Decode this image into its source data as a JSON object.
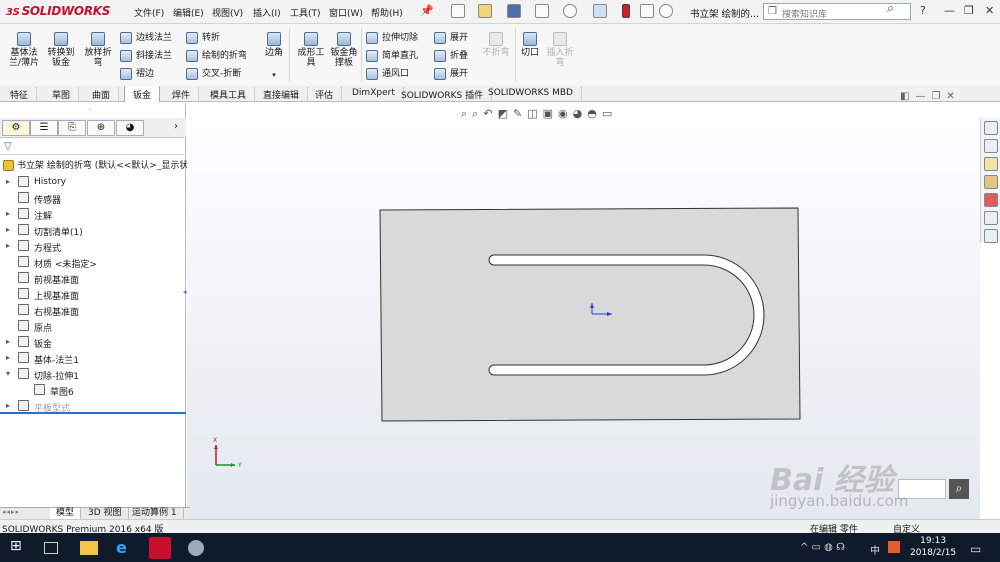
{
  "app": {
    "logo_text": "SOLIDWORKS",
    "logo_prefix": "3S",
    "document_title": "书立架 绘制的..."
  },
  "menu": [
    "文件(F)",
    "编辑(E)",
    "视图(V)",
    "插入(I)",
    "工具(T)",
    "窗口(W)",
    "帮助(H)"
  ],
  "search": {
    "placeholder": "搜索知识库"
  },
  "window_buttons": {
    "help": "?",
    "minimize": "—",
    "restore": "❐",
    "close": "✕"
  },
  "commands": {
    "base_flange": "基体法\n兰/薄片",
    "convert_to_sheet": "转换到\n钣金",
    "lofted_bend": "放样折\n弯",
    "edge_flange": "边线法兰",
    "miter_flange": "斜接法兰",
    "hem": "褶边",
    "jog": "转折",
    "sketched_bend": "绘制的折弯",
    "cross_break": "交叉-折断",
    "corners": "边角",
    "forming_tool": "成形工\n具",
    "sheet_metal_gusset": "钣金角\n撑板",
    "extruded_cut": "拉伸切除",
    "simple_hole": "简单直孔",
    "vent": "通风口",
    "unfold": "展开",
    "fold": "折叠",
    "flatten": "展开",
    "no_bends": "不折弯",
    "rip": "切口",
    "insert_bends": "插入折\n弯"
  },
  "tabs": [
    "特征",
    "草图",
    "曲面",
    "钣金",
    "焊件",
    "模具工具",
    "直接编辑",
    "评估",
    "DimXpert",
    "SOLIDWORKS 插件",
    "SOLIDWORKS MBD"
  ],
  "active_tab": "钣金",
  "tree": {
    "root": "书立架 绘制的折弯  (默认<<默认>_显示状",
    "items": [
      {
        "label": "History",
        "icon": "history-icon",
        "arrow": true
      },
      {
        "label": "传感器",
        "icon": "sensor-icon",
        "arrow": false
      },
      {
        "label": "注解",
        "icon": "annotation-icon",
        "arrow": true
      },
      {
        "label": "切割清单(1)",
        "icon": "cutlist-icon",
        "arrow": true
      },
      {
        "label": "方程式",
        "icon": "equation-icon",
        "arrow": true
      },
      {
        "label": "材质 <未指定>",
        "icon": "material-icon",
        "arrow": false
      },
      {
        "label": "前视基准面",
        "icon": "plane-icon",
        "arrow": false
      },
      {
        "label": "上视基准面",
        "icon": "plane-icon",
        "arrow": false
      },
      {
        "label": "右视基准面",
        "icon": "plane-icon",
        "arrow": false
      },
      {
        "label": "原点",
        "icon": "origin-icon",
        "arrow": false
      },
      {
        "label": "钣金",
        "icon": "sheetmetal-icon",
        "arrow": true
      },
      {
        "label": "基体-法兰1",
        "icon": "base-flange-icon",
        "arrow": true
      },
      {
        "label": "切除-拉伸1",
        "icon": "cut-extrude-icon",
        "arrow": true,
        "expanded": true
      },
      {
        "label": "草图6",
        "icon": "sketch-icon",
        "arrow": false,
        "child": true
      },
      {
        "label": "平板型式",
        "icon": "flat-pattern-icon",
        "arrow": true,
        "disabled": true
      }
    ]
  },
  "bottom_tabs": [
    "模型",
    "3D 视图",
    "运动算例 1"
  ],
  "status_text": "SOLIDWORKS Premium 2016 x64 版",
  "status_right": [
    "在编辑 零件",
    "自定义"
  ],
  "triad": {
    "x": "X",
    "y": "Y"
  },
  "clock": {
    "time": "19:13",
    "date": "2018/2/15"
  },
  "tray": {
    "ime": "中",
    "tray_icons": "^ ▭ ◍ ☊"
  },
  "watermark": {
    "main": "Bai 经验",
    "sub": "jingyan.baidu.com"
  },
  "colors": {
    "accent": "#2f6fcf",
    "logo": "#c8102e",
    "taskbar": "#0f1a2a",
    "part_face": "#d9d9d9"
  }
}
